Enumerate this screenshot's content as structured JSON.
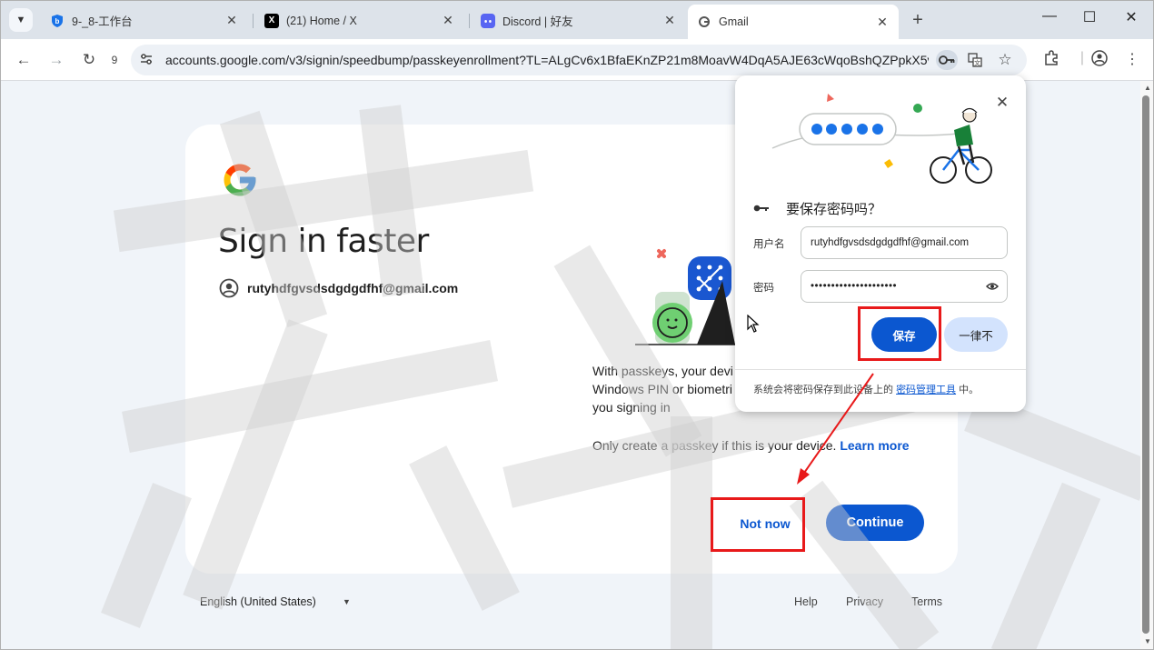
{
  "tabs": [
    {
      "title": "9-_8-工作台",
      "favicon": "shield-icon"
    },
    {
      "title": "(21) Home / X",
      "favicon": "x-logo-icon"
    },
    {
      "title": "Discord | 好友",
      "favicon": "discord-icon"
    },
    {
      "title": "Gmail",
      "favicon": "google-icon",
      "active": true
    }
  ],
  "toolbar": {
    "reload_badge": "9",
    "url": "accounts.google.com/v3/signin/speedbump/passkeyenrollment?TL=ALgCv6x1BfaEKnZP21m8MoavW4DqA5AJE63cWqoBshQZPpkX5v..."
  },
  "page": {
    "title": "Sign in faster",
    "account_email": "rutyhdfgvsdsdgdgdfhf@gmail.com",
    "body_lines": [
      "With passkeys, your devi",
      "Windows PIN or biometri",
      "you signing in"
    ],
    "only_text": "Only create a passkey if this is your device.",
    "learn_more": "Learn more",
    "not_now": "Not now",
    "continue": "Continue",
    "language": "English (United States)",
    "footer": {
      "help": "Help",
      "privacy": "Privacy",
      "terms": "Terms"
    }
  },
  "password_popup": {
    "title": "要保存密码吗？",
    "username_label": "用户名",
    "username_value": "rutyhdfgvsdsdgdgdfhf@gmail.com",
    "password_label": "密码",
    "password_mask": "•••••••••••••••••••••",
    "save": "保存",
    "never": "一律不",
    "footer_prefix": "系统会将密码保存到此设备上的",
    "footer_link": "密码管理工具",
    "footer_suffix": "中。"
  },
  "colors": {
    "accent": "#0b57d0",
    "annotation": "#e8191a",
    "page_bg": "#f0f4f9"
  }
}
